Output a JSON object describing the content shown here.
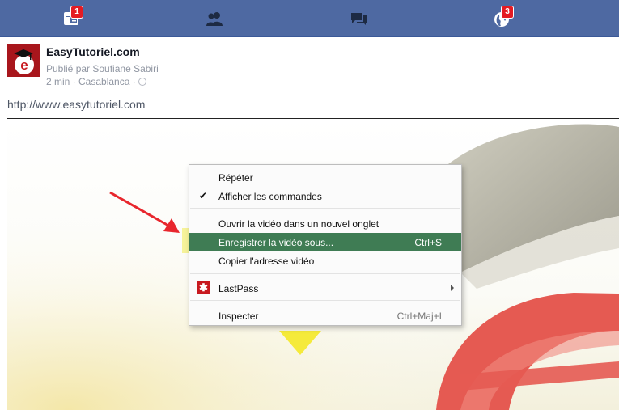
{
  "nav": {
    "items": [
      {
        "name": "news-feed",
        "badge": "1"
      },
      {
        "name": "friend-requests",
        "badge": ""
      },
      {
        "name": "messages",
        "badge": ""
      },
      {
        "name": "notifications",
        "badge": "3"
      }
    ]
  },
  "post": {
    "page_name": "EasyTutoriel.com",
    "published_by": "Publié par Soufiane Sabiri",
    "time_location": "2 min · Casablanca ·",
    "link": "http://www.easytutoriel.com",
    "avatar_letter": "e"
  },
  "context_menu": {
    "items": [
      {
        "label": "Répéter",
        "shortcut": ""
      },
      {
        "label": "Afficher les commandes",
        "shortcut": "",
        "checked": true
      },
      {
        "label": "Ouvrir la vidéo dans un nouvel onglet",
        "shortcut": ""
      },
      {
        "label": "Enregistrer la vidéo sous...",
        "shortcut": "Ctrl+S",
        "highlighted": true
      },
      {
        "label": "Copier l'adresse vidéo",
        "shortcut": ""
      },
      {
        "label": "LastPass",
        "shortcut": "",
        "icon": "lastpass-icon",
        "submenu": true
      },
      {
        "label": "Inspecter",
        "shortcut": "Ctrl+Maj+I"
      }
    ]
  },
  "colors": {
    "topbar": "#4e69a2",
    "highlight_item": "#3f7c54",
    "highlight_band": "#f6f39a",
    "arrow": "#e8262d",
    "badge": "#e41b23"
  }
}
